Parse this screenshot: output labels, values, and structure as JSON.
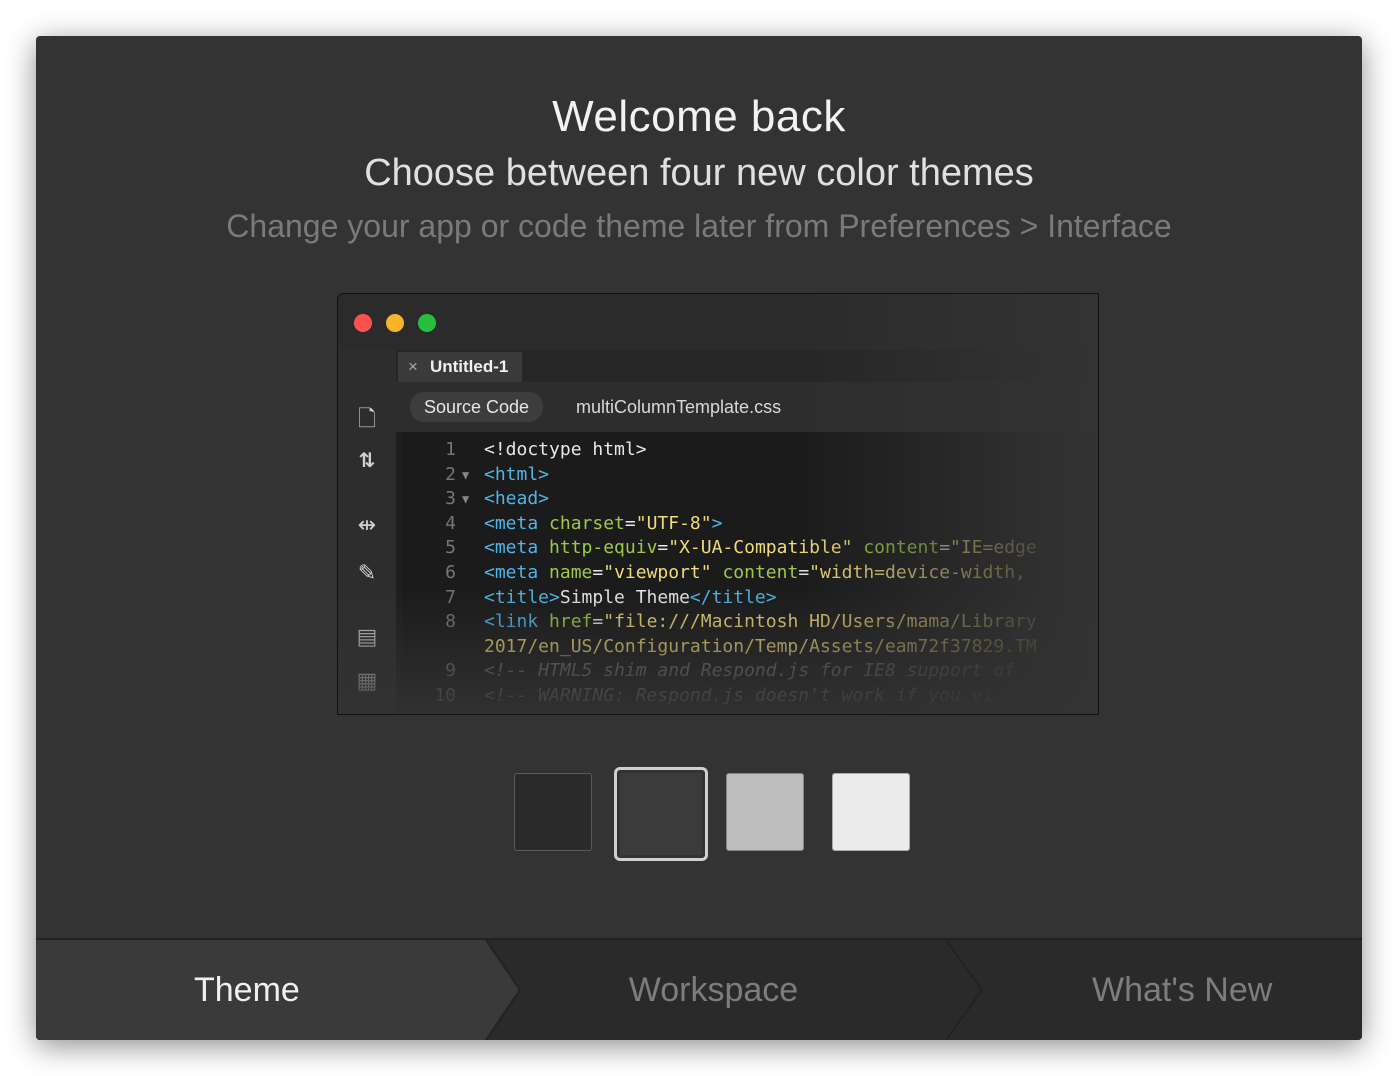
{
  "header": {
    "title": "Welcome back",
    "subtitle": "Choose between four new color themes",
    "hint": "Change your app or code theme later from Preferences > Interface"
  },
  "preview": {
    "document_tab": "Untitled-1",
    "related_files": [
      "Source Code",
      "multiColumnTemplate.css"
    ],
    "toolbar_icons": [
      "file-icon",
      "arrows-up-down-icon",
      "expand-icon",
      "brush-icon",
      "comment-icon",
      "comment-settings-icon"
    ],
    "code_lines": [
      {
        "n": "1",
        "fold": "",
        "html": "&lt;!doctype html&gt;"
      },
      {
        "n": "2",
        "fold": "▼",
        "html": "<span class='tag'>&lt;html&gt;</span>"
      },
      {
        "n": "3",
        "fold": "▼",
        "html": "<span class='tag'>&lt;head&gt;</span>"
      },
      {
        "n": "4",
        "fold": "",
        "html": "<span class='tag'>&lt;meta</span> <span class='attr'>charset</span>=<span class='str'>\"UTF-8\"</span><span class='tag'>&gt;</span>"
      },
      {
        "n": "5",
        "fold": "",
        "html": "<span class='tag'>&lt;meta</span> <span class='attr'>http-equiv</span>=<span class='str'>\"X-UA-Compatible\"</span> <span class='attr'>content</span>=<span class='str'>\"IE=edge</span>"
      },
      {
        "n": "6",
        "fold": "",
        "html": "<span class='tag'>&lt;meta</span> <span class='attr'>name</span>=<span class='str'>\"viewport\"</span> <span class='attr'>content</span>=<span class='str'>\"width=device-width,</span>"
      },
      {
        "n": "7",
        "fold": "",
        "html": "<span class='tag'>&lt;title&gt;</span>Simple Theme<span class='tag'>&lt;/title&gt;</span>"
      },
      {
        "n": "8",
        "fold": "",
        "html": "<span class='tag'>&lt;link</span> <span class='attr'>href</span>=<span class='str'>\"file:///Macintosh HD/Users/mama/Library</span>"
      },
      {
        "n": "",
        "fold": "",
        "html": "<span class='str'>2017/en_US/Configuration/Temp/Assets/eam72f37829.TM</span>"
      },
      {
        "n": "9",
        "fold": "",
        "html": "<span class='cmt'>&lt;!-- HTML5 shim and Respond.js for IE8 support of</span>"
      },
      {
        "n": "10",
        "fold": "",
        "html": "<span class='cmt'>&lt;!-- WARNING: Respond.js doesn't work if you vi</span>"
      }
    ]
  },
  "themes": [
    {
      "name": "darkest",
      "color": "#2a2a2a",
      "selected": false
    },
    {
      "name": "dark",
      "color": "#3b3b3b",
      "selected": true
    },
    {
      "name": "light",
      "color": "#bdbdbd",
      "selected": false
    },
    {
      "name": "lightest",
      "color": "#ececec",
      "selected": false
    }
  ],
  "steps": {
    "theme": "Theme",
    "workspace": "Workspace",
    "whats_new": "What's New"
  }
}
